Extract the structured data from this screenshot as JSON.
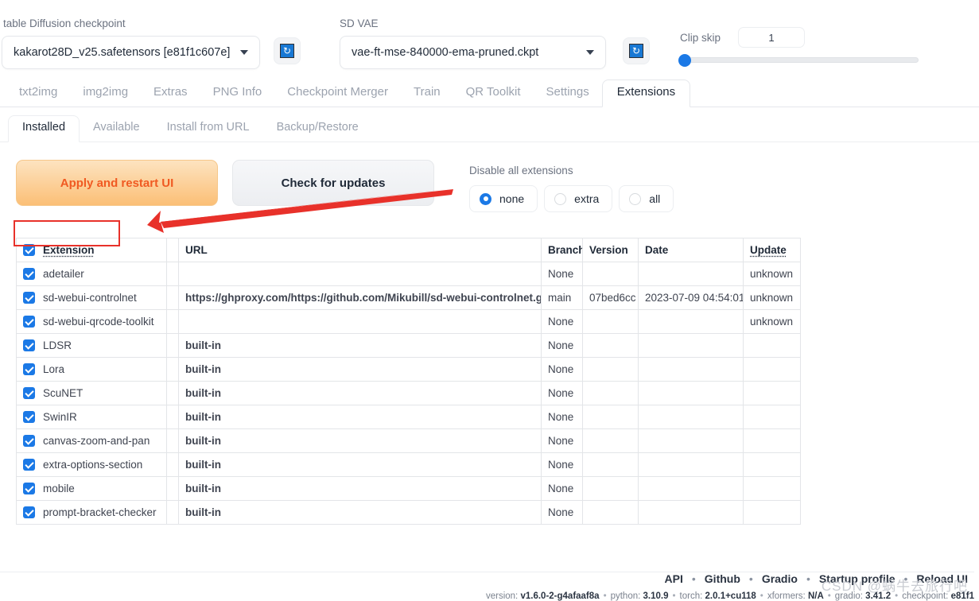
{
  "top": {
    "checkpoint_label": "table Diffusion checkpoint",
    "checkpoint_value": "kakarot28D_v25.safetensors [e81f1c607e]",
    "vae_label": "SD VAE",
    "vae_value": "vae-ft-mse-840000-ema-pruned.ckpt",
    "refresh_glyph": "↻",
    "clip_skip_label": "Clip skip",
    "clip_skip_value": "1"
  },
  "main_tabs": [
    {
      "label": "txt2img",
      "active": false
    },
    {
      "label": "img2img",
      "active": false
    },
    {
      "label": "Extras",
      "active": false
    },
    {
      "label": "PNG Info",
      "active": false
    },
    {
      "label": "Checkpoint Merger",
      "active": false
    },
    {
      "label": "Train",
      "active": false
    },
    {
      "label": "QR Toolkit",
      "active": false
    },
    {
      "label": "Settings",
      "active": false
    },
    {
      "label": "Extensions",
      "active": true
    }
  ],
  "sub_tabs": [
    {
      "label": "Installed",
      "active": true
    },
    {
      "label": "Available",
      "active": false
    },
    {
      "label": "Install from URL",
      "active": false
    },
    {
      "label": "Backup/Restore",
      "active": false
    }
  ],
  "panel": {
    "apply_label": "Apply and restart UI",
    "check_label": "Check for updates",
    "disable_title": "Disable all extensions",
    "disable_options": [
      {
        "label": "none",
        "selected": true
      },
      {
        "label": "extra",
        "selected": false
      },
      {
        "label": "all",
        "selected": false
      }
    ]
  },
  "table": {
    "headers": [
      "Extension",
      "",
      "URL",
      "Branch",
      "Version",
      "Date",
      "Update"
    ],
    "rows": [
      {
        "checked": true,
        "extension": "adetailer",
        "url": "",
        "branch": "None",
        "version": "",
        "date": "",
        "update": "unknown"
      },
      {
        "checked": true,
        "extension": "sd-webui-controlnet",
        "url": "https://ghproxy.com/https://github.com/Mikubill/sd-webui-controlnet.git",
        "branch": "main",
        "version": "07bed6cc",
        "date": "2023-07-09 04:54:01",
        "update": "unknown"
      },
      {
        "checked": true,
        "extension": "sd-webui-qrcode-toolkit",
        "url": "",
        "branch": "None",
        "version": "",
        "date": "",
        "update": "unknown"
      },
      {
        "checked": true,
        "extension": "LDSR",
        "url": "built-in",
        "branch": "None",
        "version": "",
        "date": "",
        "update": ""
      },
      {
        "checked": true,
        "extension": "Lora",
        "url": "built-in",
        "branch": "None",
        "version": "",
        "date": "",
        "update": ""
      },
      {
        "checked": true,
        "extension": "ScuNET",
        "url": "built-in",
        "branch": "None",
        "version": "",
        "date": "",
        "update": ""
      },
      {
        "checked": true,
        "extension": "SwinIR",
        "url": "built-in",
        "branch": "None",
        "version": "",
        "date": "",
        "update": ""
      },
      {
        "checked": true,
        "extension": "canvas-zoom-and-pan",
        "url": "built-in",
        "branch": "None",
        "version": "",
        "date": "",
        "update": ""
      },
      {
        "checked": true,
        "extension": "extra-options-section",
        "url": "built-in",
        "branch": "None",
        "version": "",
        "date": "",
        "update": ""
      },
      {
        "checked": true,
        "extension": "mobile",
        "url": "built-in",
        "branch": "None",
        "version": "",
        "date": "",
        "update": ""
      },
      {
        "checked": true,
        "extension": "prompt-bracket-checker",
        "url": "built-in",
        "branch": "None",
        "version": "",
        "date": "",
        "update": ""
      }
    ]
  },
  "footer": {
    "links": [
      "API",
      "Github",
      "Gradio",
      "Startup profile",
      "Reload UI"
    ],
    "separator": "•",
    "version_parts": [
      {
        "key": "version:",
        "value": "v1.6.0-2-g4afaaf8a"
      },
      {
        "key": "python:",
        "value": "3.10.9"
      },
      {
        "key": "torch:",
        "value": "2.0.1+cu118"
      },
      {
        "key": "xformers:",
        "value": "N/A"
      },
      {
        "key": "gradio:",
        "value": "3.41.2"
      },
      {
        "key": "checkpoint:",
        "value": "e81f1"
      }
    ]
  },
  "annotations": {
    "highlight_color": "#e8312a",
    "arrow_color": "#e8312a",
    "watermark": "CSDN @蜗牛去旅行吧"
  }
}
